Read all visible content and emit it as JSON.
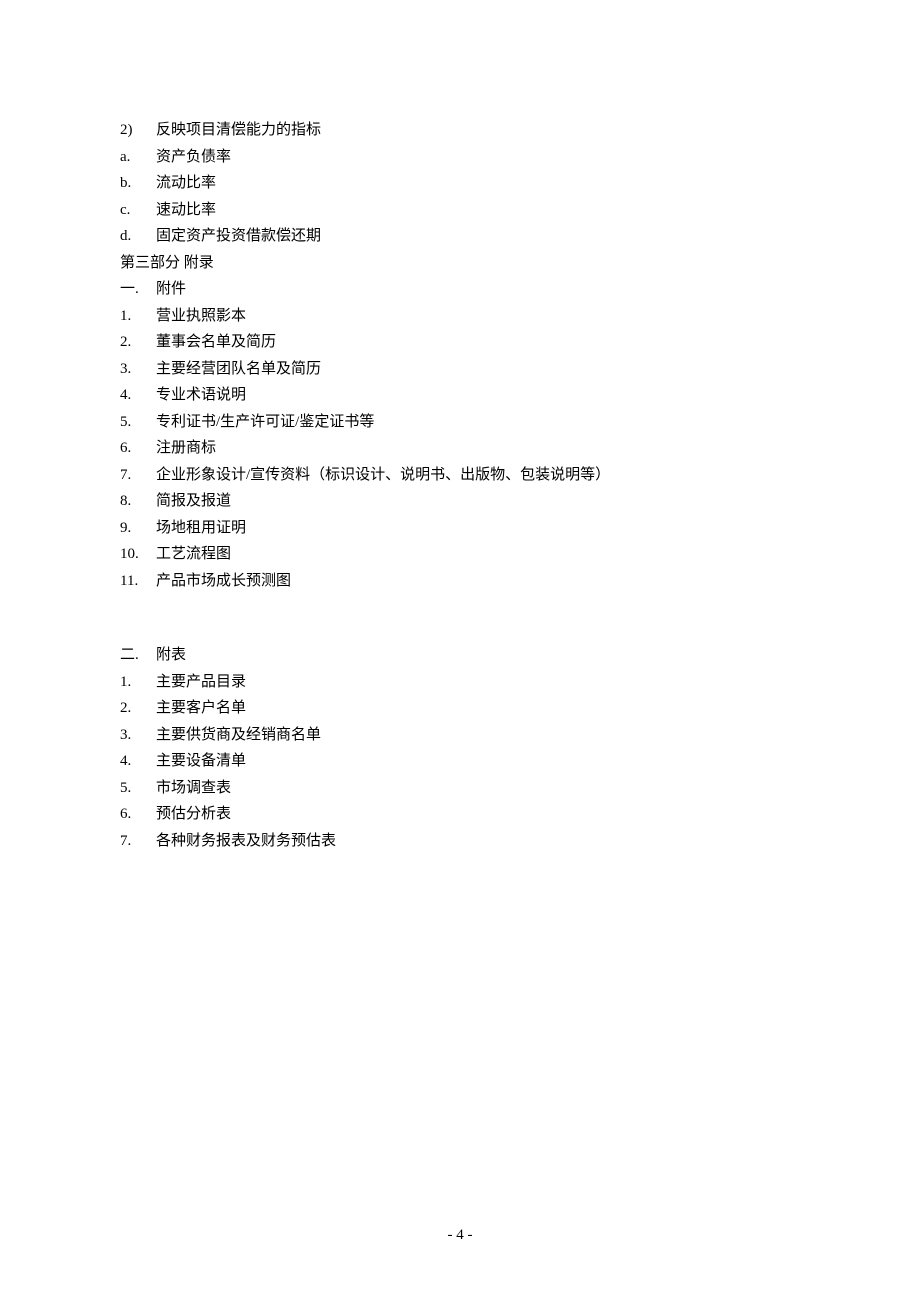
{
  "lines": [
    {
      "marker": "2)",
      "markerClass": "marker",
      "text": "反映项目清偿能力的指标"
    },
    {
      "marker": "a.",
      "markerClass": "marker",
      "text": "资产负债率"
    },
    {
      "marker": "b.",
      "markerClass": "marker",
      "text": "流动比率"
    },
    {
      "marker": "c.",
      "markerClass": "marker",
      "text": "速动比率"
    },
    {
      "marker": "d.",
      "markerClass": "marker",
      "text": "固定资产投资借款偿还期"
    }
  ],
  "sectionHeader1": "第三部分  附录",
  "subheading1": {
    "marker": "一.",
    "text": "附件"
  },
  "list1": [
    {
      "marker": "1.",
      "text": "营业执照影本"
    },
    {
      "marker": "2.",
      "text": "董事会名单及简历"
    },
    {
      "marker": "3.",
      "text": "主要经营团队名单及简历"
    },
    {
      "marker": "4.",
      "text": "专业术语说明"
    },
    {
      "marker": "5.",
      "text": "专利证书/生产许可证/鉴定证书等"
    },
    {
      "marker": "6.",
      "text": "注册商标"
    },
    {
      "marker": "7.",
      "text": "企业形象设计/宣传资料（标识设计、说明书、出版物、包装说明等）"
    },
    {
      "marker": "8.",
      "text": "简报及报道"
    },
    {
      "marker": "9.",
      "text": "场地租用证明"
    },
    {
      "marker": "10.",
      "text": "工艺流程图"
    },
    {
      "marker": "11.",
      "text": "产品市场成长预测图"
    }
  ],
  "subheading2": {
    "marker": "二.",
    "text": "附表"
  },
  "list2": [
    {
      "marker": "1.",
      "text": "主要产品目录"
    },
    {
      "marker": "2.",
      "text": "主要客户名单"
    },
    {
      "marker": "3.",
      "text": "主要供货商及经销商名单"
    },
    {
      "marker": "4.",
      "text": "主要设备清单"
    },
    {
      "marker": "5.",
      "text": "市场调查表"
    },
    {
      "marker": "6.",
      "text": "预估分析表"
    },
    {
      "marker": "7.",
      "text": "各种财务报表及财务预估表"
    }
  ],
  "pageNumber": "- 4 -"
}
